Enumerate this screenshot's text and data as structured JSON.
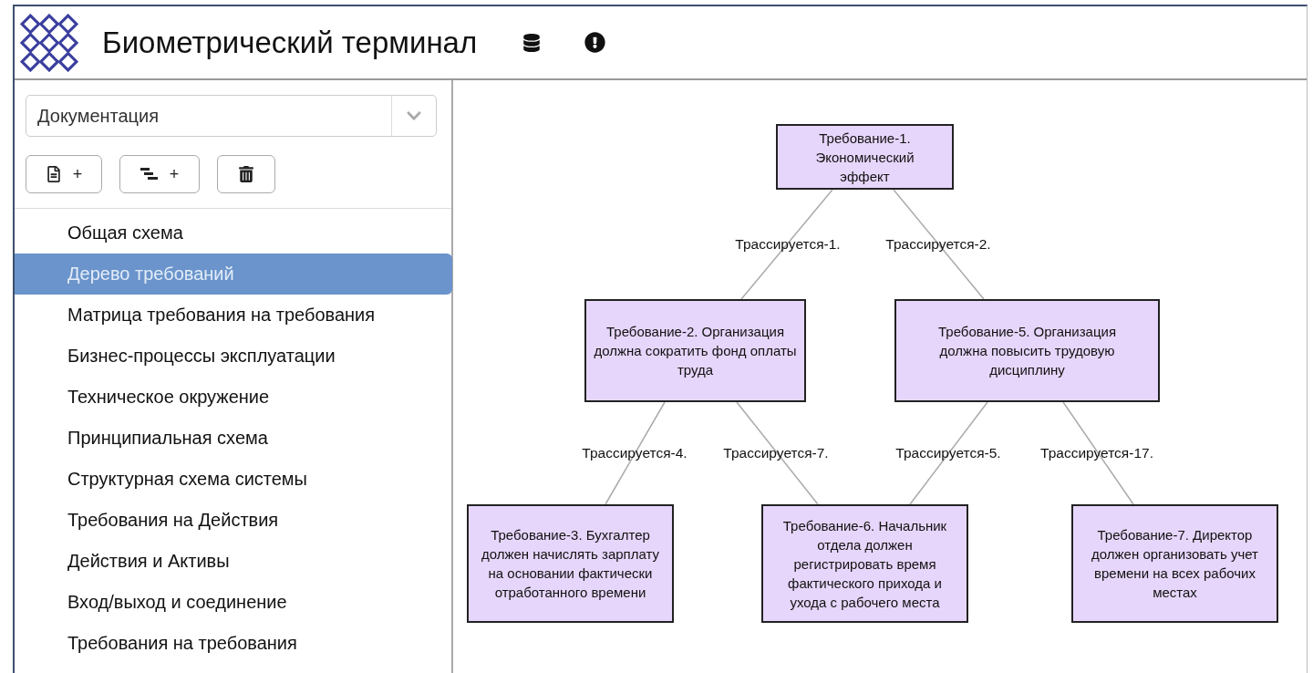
{
  "header": {
    "title": "Биометрический терминал"
  },
  "sidebar": {
    "dropdown": {
      "value": "Документация"
    },
    "buttons": [
      {
        "kind": "add-document",
        "label": "+"
      },
      {
        "kind": "add-tree",
        "label": "+"
      },
      {
        "kind": "delete"
      }
    ],
    "items": [
      {
        "label": "Общая схема",
        "selected": false
      },
      {
        "label": "Дерево требований",
        "selected": true
      },
      {
        "label": "Матрица требования на требования",
        "selected": false
      },
      {
        "label": "Бизнес-процессы эксплуатации",
        "selected": false
      },
      {
        "label": "Техническое окружение",
        "selected": false
      },
      {
        "label": "Принципиальная схема",
        "selected": false
      },
      {
        "label": "Структурная схема системы",
        "selected": false
      },
      {
        "label": "Требования на Действия",
        "selected": false
      },
      {
        "label": "Действия и Активы",
        "selected": false
      },
      {
        "label": "Вход/выход и соединение",
        "selected": false
      },
      {
        "label": "Требования на требования",
        "selected": false
      }
    ]
  },
  "diagram": {
    "nodes": [
      {
        "text": "Требование-1. Экономический эффект"
      },
      {
        "text": "Требование-2. Организация должна сократить фонд оплаты труда"
      },
      {
        "text": "Требование-5. Организация должна повысить трудовую дисциплину"
      },
      {
        "text": "Требование-3. Бухгалтер должен начислять зарплату на основании фактически отработанного времени"
      },
      {
        "text": "Требование-6. Начальник отдела должен регистрировать время фактического прихода и ухода с рабочего места"
      },
      {
        "text": "Требование-7. Директор должен организовать учет времени на всех рабочих местах"
      }
    ],
    "links": [
      {
        "label": "Трассируется-1."
      },
      {
        "label": "Трассируется-2."
      },
      {
        "label": "Трассируется-4."
      },
      {
        "label": "Трассируется-7."
      },
      {
        "label": "Трассируется-5."
      },
      {
        "label": "Трассируется-17."
      }
    ]
  }
}
